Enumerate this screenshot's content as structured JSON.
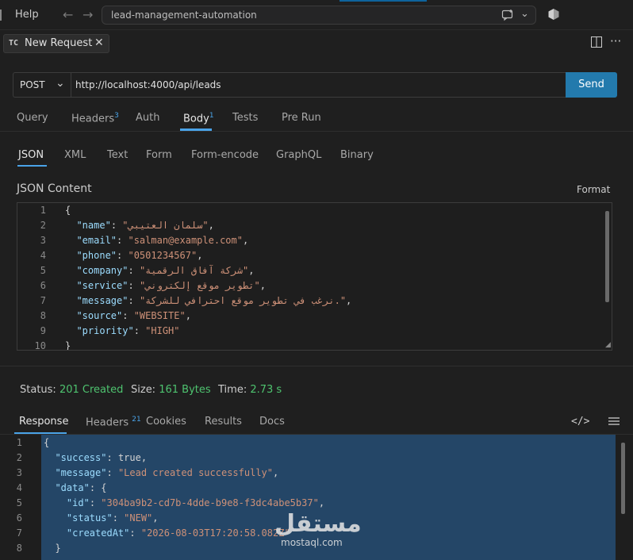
{
  "menu": {
    "help": "Help"
  },
  "command_center": {
    "text": "lead-management-automation"
  },
  "tab": {
    "badge": "TC",
    "title": "New Request"
  },
  "request": {
    "method": "POST",
    "url": "http://localhost:4000/api/leads",
    "send_label": "Send"
  },
  "request_tabs": [
    {
      "label": "Query",
      "count": ""
    },
    {
      "label": "Headers",
      "count": "3"
    },
    {
      "label": "Auth",
      "count": ""
    },
    {
      "label": "Body",
      "count": "1"
    },
    {
      "label": "Tests",
      "count": ""
    },
    {
      "label": "Pre Run",
      "count": ""
    }
  ],
  "body_tabs": [
    "JSON",
    "XML",
    "Text",
    "Form",
    "Form-encode",
    "GraphQL",
    "Binary"
  ],
  "editor": {
    "title": "JSON Content",
    "format_label": "Format",
    "line_numbers": [
      "1",
      "2",
      "3",
      "4",
      "5",
      "6",
      "7",
      "8",
      "9",
      "10"
    ],
    "lines": {
      "l1": "{",
      "l2k": "\"name\"",
      "l2v": "\"سلمان العتيبي\"",
      "l3k": "\"email\"",
      "l3v": "\"salman@example.com\"",
      "l4k": "\"phone\"",
      "l4v": "\"0501234567\"",
      "l5k": "\"company\"",
      "l5v": "\"شركة آفاق الرقمية\"",
      "l6k": "\"service\"",
      "l6v": "\"تطوير موقع إلكتروني\"",
      "l7k": "\"message\"",
      "l7v": "\"نرغب في تطوير موقع احترافي للشركة.\"",
      "l8k": "\"source\"",
      "l8v": "\"WEBSITE\"",
      "l9k": "\"priority\"",
      "l9v": "\"HIGH\"",
      "l10": "}"
    }
  },
  "status": {
    "status_label": "Status:",
    "status_value": "201 Created",
    "size_label": "Size:",
    "size_value": "161 Bytes",
    "time_label": "Time:",
    "time_value": "2.73 s"
  },
  "response_tabs": [
    {
      "label": "Response",
      "count": ""
    },
    {
      "label": "Headers",
      "count": "21"
    },
    {
      "label": "Cookies",
      "count": ""
    },
    {
      "label": "Results",
      "count": ""
    },
    {
      "label": "Docs",
      "count": ""
    }
  ],
  "response": {
    "line_numbers": [
      "1",
      "2",
      "3",
      "4",
      "5",
      "6",
      "7",
      "8"
    ],
    "lines": {
      "l1": "{",
      "l2k": "\"success\"",
      "l2v": "true",
      "l3k": "\"message\"",
      "l3v": "\"Lead created successfully\"",
      "l4k": "\"data\"",
      "l4v": "{",
      "l5k": "\"id\"",
      "l5v": "\"304ba9b2-cd7b-4dde-b9e8-f3dc4abe5b37\"",
      "l6k": "\"status\"",
      "l6v": "\"NEW\"",
      "l7k": "\"createdAt\"",
      "l7v": "\"2026-08-03T17:20:58.082Z\"",
      "l8": "}"
    }
  },
  "watermark": {
    "logo": "مستقل",
    "site": "mostaql.com"
  },
  "icons": [
    "back-arrow-icon",
    "forward-arrow-icon",
    "chat-add-icon",
    "chevron-down-icon",
    "copilot-icon",
    "split-editor-icon",
    "more-icon",
    "close-icon",
    "code-icon",
    "menu-icon"
  ]
}
